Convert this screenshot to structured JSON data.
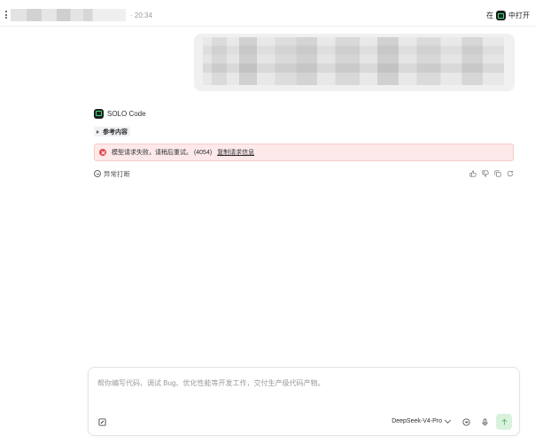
{
  "header": {
    "time": "· 20:34",
    "open_in_prefix": "在",
    "open_in_label": "中打开"
  },
  "assistant": {
    "agent_name": "SOLO Code",
    "reference_label": "参考内容",
    "error_text": "模型请求失败，请稍后重试。 (4054)",
    "error_link": "复制请求信息",
    "interrupted_label": "异常打断"
  },
  "composer": {
    "placeholder": "帮你编写代码、调试 Bug、优化性能等开发工作，交付生产级代码产物。",
    "model": "DeepSeek-V4-Pro"
  },
  "icons": {
    "more": "more-vertical-icon",
    "app": "solo-app-icon",
    "error": "error-circle-icon",
    "interrupt": "minus-circle-icon",
    "thumbs_up": "thumbs-up-icon",
    "thumbs_down": "thumbs-down-icon",
    "copy": "copy-icon",
    "regenerate": "refresh-icon",
    "edit": "edit-box-icon",
    "context": "context-icon",
    "mic": "microphone-icon",
    "send": "send-arrow-icon"
  },
  "colors": {
    "error_bg": "#fde9e9",
    "error_icon": "#e5484d",
    "brand_green": "#3ddc84",
    "send_bg": "#d9f2dd"
  }
}
